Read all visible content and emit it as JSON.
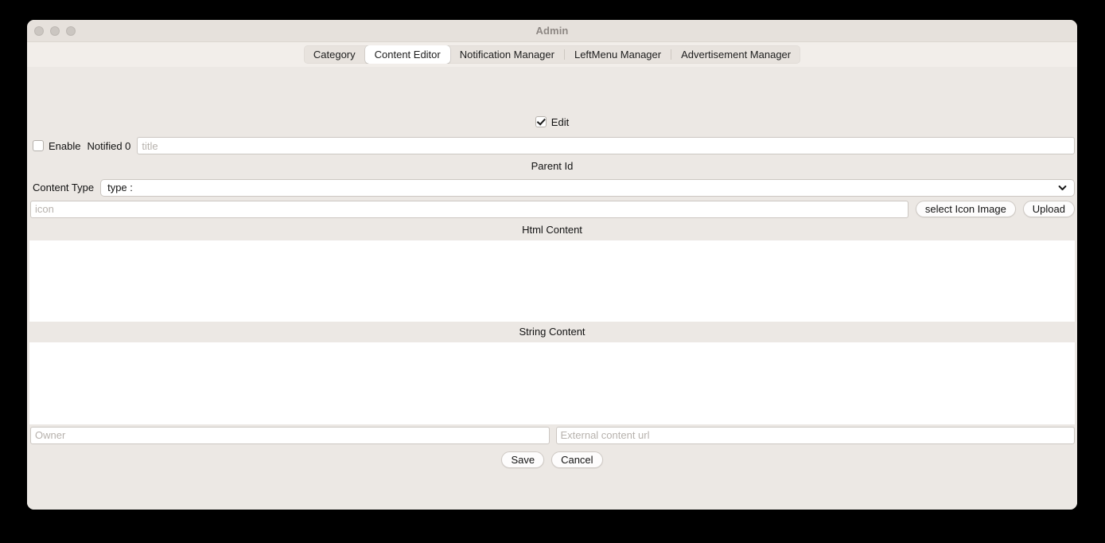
{
  "window": {
    "title": "Admin",
    "traffic_lights": [
      "close-button",
      "minimize-button",
      "zoom-button"
    ]
  },
  "tabs": [
    {
      "label": "Category",
      "selected": false
    },
    {
      "label": "Content Editor",
      "selected": true
    },
    {
      "label": "Notification Manager",
      "selected": false
    },
    {
      "label": "LeftMenu Manager",
      "selected": false
    },
    {
      "label": "Advertisement Manager",
      "selected": false
    }
  ],
  "form": {
    "edit_checkbox": {
      "label": "Edit",
      "checked": true
    },
    "enable_checkbox": {
      "label": "Enable",
      "checked": false
    },
    "notified": {
      "label": "Notified 0"
    },
    "title_field": {
      "value": "",
      "placeholder": "title"
    },
    "parent_id_label": "Parent Id",
    "content_type_label": "Content Type",
    "content_type_select": {
      "value": "type :",
      "options": [
        "type :"
      ]
    },
    "icon_field": {
      "value": "",
      "placeholder": "icon"
    },
    "select_icon_button": "select Icon Image",
    "upload_button": "Upload",
    "html_content_label": "Html Content",
    "html_content_value": "",
    "string_content_label": "String Content",
    "string_content_value": "",
    "owner_field": {
      "value": "",
      "placeholder": "Owner"
    },
    "external_url_field": {
      "value": "",
      "placeholder": "External content url"
    },
    "save_button": "Save",
    "cancel_button": "Cancel"
  },
  "colors": {
    "window_bg": "#ece8e4",
    "titlebar_bg": "#e6e1dc",
    "tabbar_bg": "#f2eeea",
    "selected_tab_bg": "#ffffff",
    "content_white": "#ffffff",
    "text": "#121212",
    "title_text": "#8d8783",
    "placeholder": "#b7b2ad"
  }
}
